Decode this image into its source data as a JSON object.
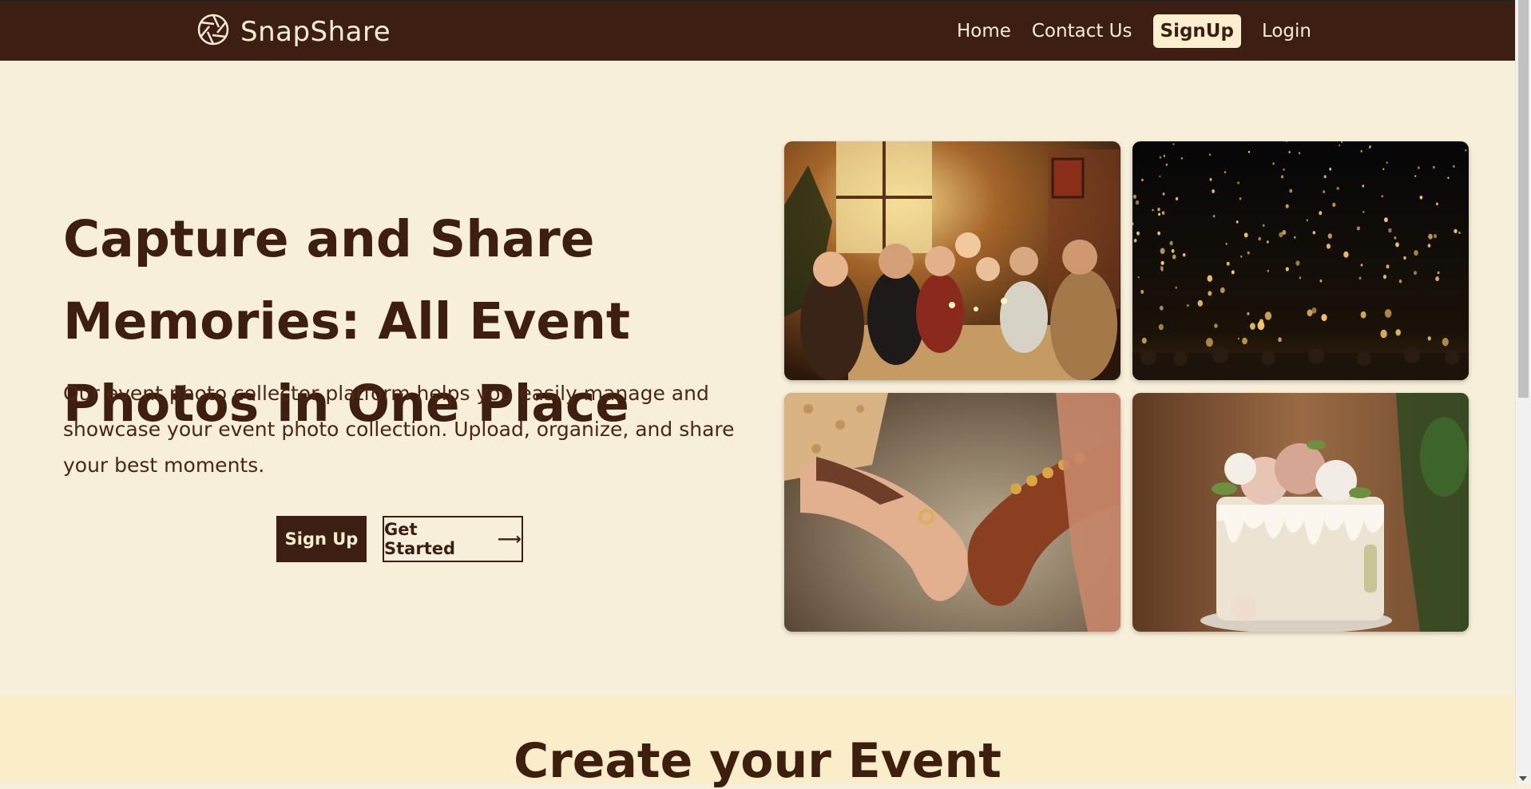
{
  "nav": {
    "brand": "SnapShare",
    "links": {
      "home": "Home",
      "contact": "Contact Us",
      "signup": "SignUp",
      "login": "Login"
    }
  },
  "hero": {
    "title": "Capture and Share Memories: All Event Photos in One Place",
    "description": "Our event photo collector platform helps you easily manage and showcase your event photo collection. Upload, organize, and share your best moments.",
    "signup_label": "Sign Up",
    "get_started_label": "Get Started",
    "arrow": "⟶"
  },
  "section2": {
    "title": "Create your Event"
  },
  "colors": {
    "nav_bg": "#3d1e12",
    "page_bg": "#f7efd9",
    "accent": "#fbefcf",
    "text": "#3d1e0f"
  }
}
